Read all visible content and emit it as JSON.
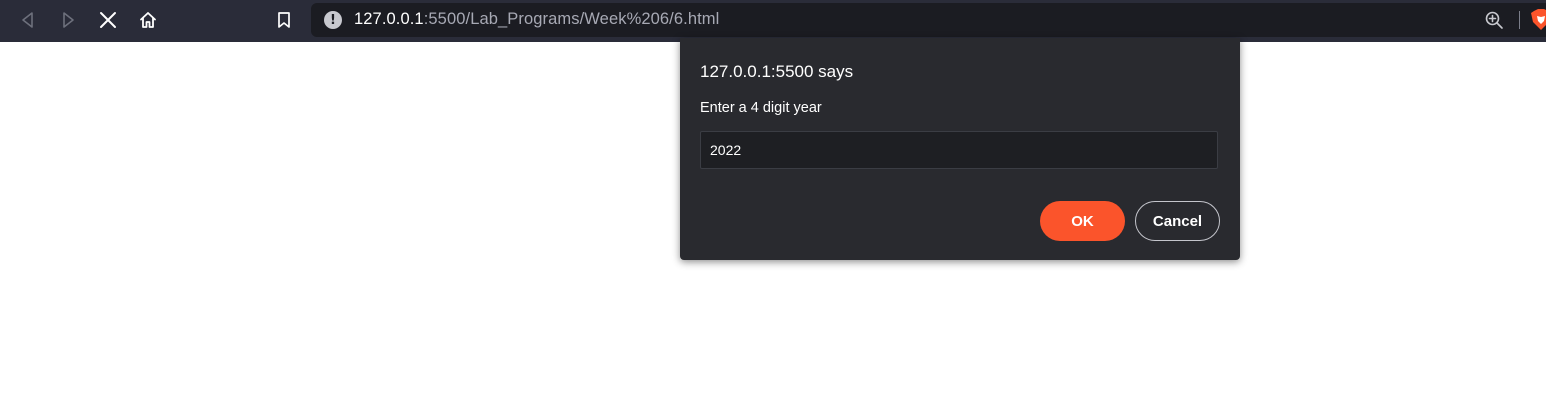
{
  "browser": {
    "toolbar_color": "#2a2c39",
    "nav": {
      "back_icon": "back-arrow-icon",
      "forward_icon": "forward-arrow-icon",
      "stop_icon": "close-icon",
      "home_icon": "home-icon",
      "bookmark_icon": "bookmark-icon"
    },
    "url": {
      "host": "127.0.0.1",
      "rest": ":5500/Lab_Programs/Week%206/6.html",
      "info_icon": "!"
    }
  },
  "dialog": {
    "title": "127.0.0.1:5500 says",
    "message": "Enter a 4 digit year",
    "input_value": "2022",
    "ok_label": "OK",
    "cancel_label": "Cancel",
    "accent_color": "#fb542b",
    "background_color": "#292a2f"
  }
}
